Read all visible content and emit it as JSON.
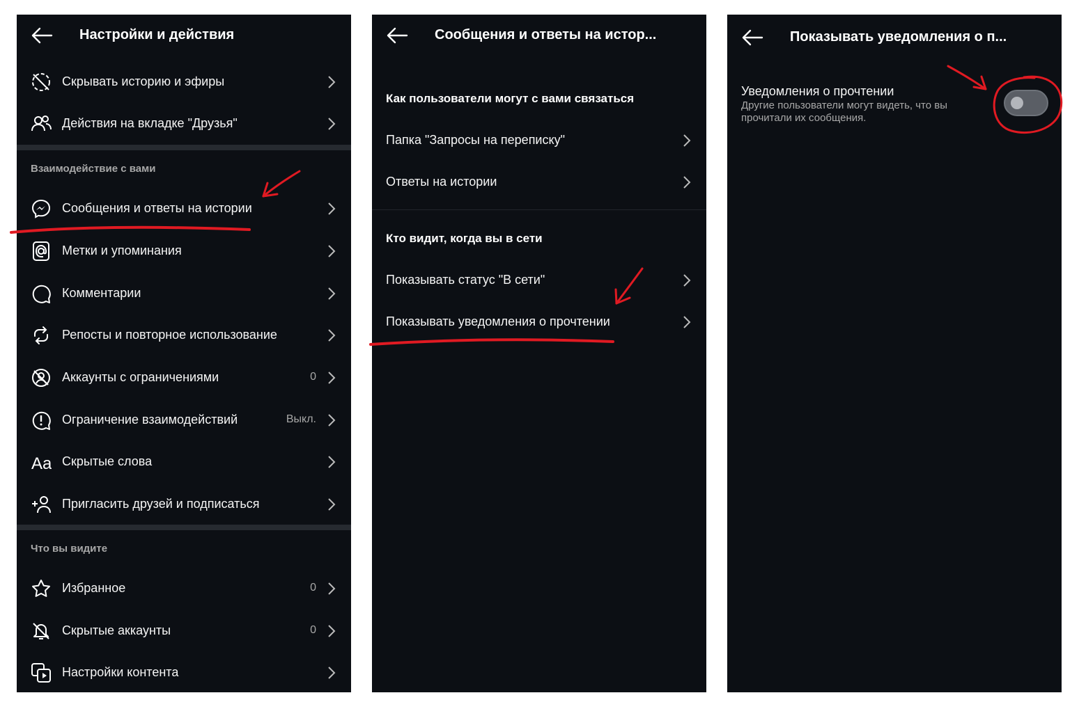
{
  "panel1": {
    "title": "Настройки и действия",
    "top_items": [
      {
        "label": "Скрывать историю и эфиры",
        "icon": "hide-story-icon"
      },
      {
        "label": "Действия на вкладке \"Друзья\"",
        "icon": "friends-icon"
      }
    ],
    "section1": "Взаимодействие с вами",
    "section1_items": [
      {
        "label": "Сообщения и ответы на истории",
        "icon": "messenger-icon"
      },
      {
        "label": "Метки и упоминания",
        "icon": "at-sign-icon"
      },
      {
        "label": "Комментарии",
        "icon": "comment-icon"
      },
      {
        "label": "Репосты и повторное использование",
        "icon": "repost-icon"
      },
      {
        "label": "Аккаунты с ограничениями",
        "icon": "restricted-icon",
        "value": "0"
      },
      {
        "label": "Ограничение взаимодействий",
        "icon": "limit-icon",
        "value": "Выкл."
      },
      {
        "label": "Скрытые слова",
        "icon": "font-aa-icon"
      },
      {
        "label": "Пригласить друзей и подписаться",
        "icon": "add-person-icon"
      }
    ],
    "section2": "Что вы видите",
    "section2_items": [
      {
        "label": "Избранное",
        "icon": "star-icon",
        "value": "0"
      },
      {
        "label": "Скрытые аккаунты",
        "icon": "muted-icon",
        "value": "0"
      },
      {
        "label": "Настройки контента",
        "icon": "content-icon"
      }
    ]
  },
  "panel2": {
    "title": "Сообщения и ответы на истор...",
    "heading1": "Как пользователи могут с вами связаться",
    "items1": [
      "Папка \"Запросы на переписку\"",
      "Ответы на истории"
    ],
    "heading2": "Кто видит, когда вы в сети",
    "items2": [
      "Показывать статус \"В сети\"",
      "Показывать уведомления о прочтении"
    ]
  },
  "panel3": {
    "title": "Показывать уведомления о п...",
    "setting_title": "Уведомления о прочтении",
    "setting_desc": "Другие пользователи могут видеть, что вы прочитали их сообщения.",
    "toggle_on": false
  },
  "colors": {
    "background": "#0c0f14",
    "text": "#f5f5f5",
    "muted": "#a8a8a8",
    "annotation": "#e01a22"
  }
}
